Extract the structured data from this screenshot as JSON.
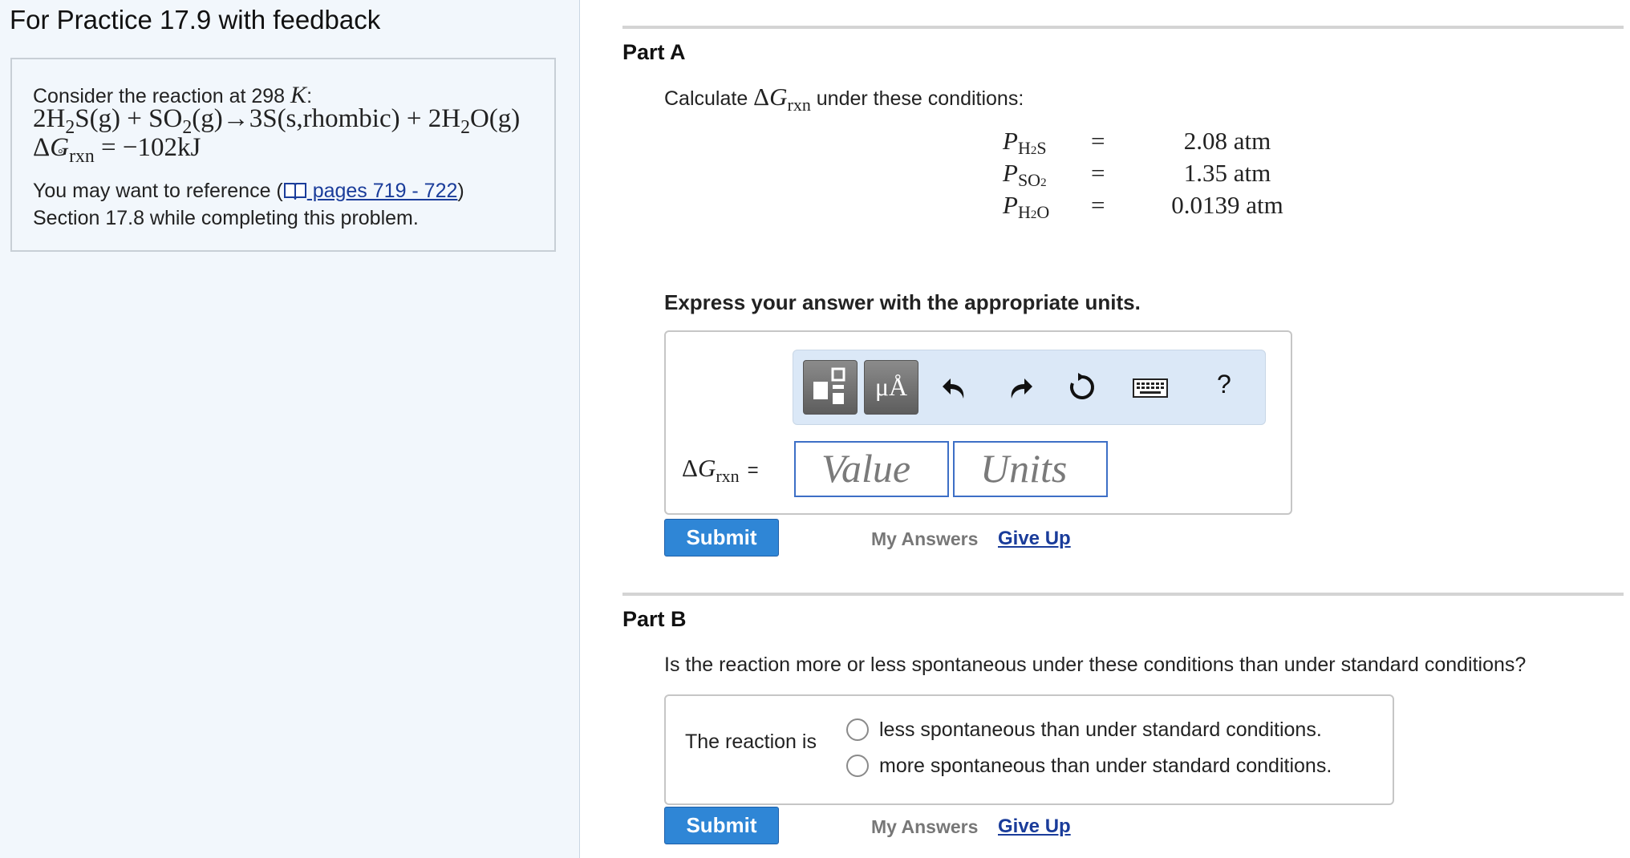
{
  "left": {
    "title": "For Practice 17.9 with feedback",
    "consider_prefix": "Consider the reaction at 298 ",
    "consider_var": "K",
    "consider_suffix": ":",
    "reaction": {
      "p1": "2H",
      "p1_sub": "2",
      "p2": "S(g) + SO",
      "p2_sub": "2",
      "p3": "(g)→3S(s,rhombic) + 2H",
      "p3_sub": "2",
      "p4": "O(g)"
    },
    "dg": {
      "delta": "Δ",
      "g": "G",
      "sup": "°",
      "sub": "rxn",
      "value": " = −102kJ"
    },
    "ref_prefix": "You may want to reference (",
    "ref_link": " pages 719 - 722",
    "ref_suffix": ")",
    "section_text": "Section 17.8 while completing this problem."
  },
  "partA": {
    "label": "Part A",
    "calc_prefix": "Calculate ",
    "calc_delta": "Δ",
    "calc_g": "G",
    "calc_sub": "rxn",
    "calc_suffix": " under these conditions:",
    "conditions": [
      {
        "p": "P",
        "sub1": "H",
        "sub2": "2",
        "sub3": "S",
        "eq": "=",
        "value": "2.08 atm"
      },
      {
        "p": "P",
        "sub1": "SO",
        "sub2": "2",
        "sub3": "",
        "eq": "=",
        "value": "1.35 atm"
      },
      {
        "p": "P",
        "sub1": "H",
        "sub2": "2",
        "sub3": "O",
        "eq": "=",
        "value": "0.0139 atm"
      }
    ],
    "express": "Express your answer with the appropriate units.",
    "toolbar": {
      "units_btn": "μÅ",
      "help": "?",
      "icons": [
        "templates-icon",
        "units-icon",
        "undo-icon",
        "redo-icon",
        "reset-icon",
        "keyboard-icon",
        "help-icon"
      ]
    },
    "answer_label": {
      "delta": "Δ",
      "g": "G",
      "sub": "rxn",
      "eq": "="
    },
    "value_placeholder": "Value",
    "units_placeholder": "Units",
    "submit": "Submit",
    "my_answers": "My Answers",
    "give_up": "Give Up"
  },
  "partB": {
    "label": "Part B",
    "question": "Is the reaction more or less spontaneous under these conditions than under standard conditions?",
    "prompt": "The reaction is",
    "options": [
      "less spontaneous than under standard conditions.",
      "more spontaneous than under standard conditions."
    ],
    "submit": "Submit",
    "my_answers": "My Answers",
    "give_up": "Give Up"
  },
  "colors": {
    "left_bg": "#f2f7fc",
    "link": "#1a3c9a",
    "submit_bg": "#2f86d6",
    "toolbar_bg": "#dbe8f7",
    "input_border": "#3d6fc6"
  }
}
